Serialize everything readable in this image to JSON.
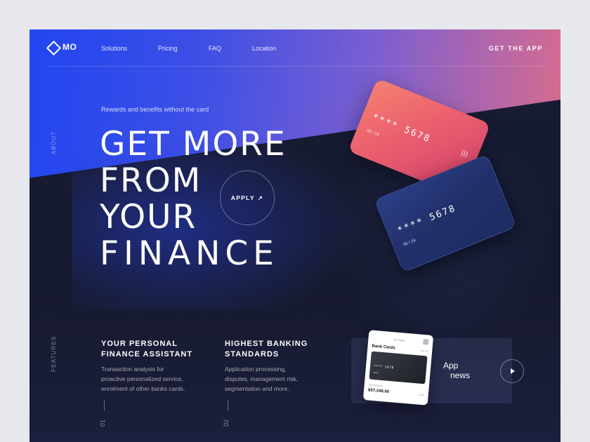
{
  "nav": {
    "logo": "MO",
    "links": [
      "Solutions",
      "Pricing",
      "FAQ",
      "Location"
    ],
    "cta": "GET THE APP"
  },
  "side_labels": {
    "about": "ABOUT",
    "features": "FEATURES"
  },
  "hero": {
    "tagline": "Rewards and benefits without the card",
    "headline": [
      "GET MORE",
      "FROM",
      "YOUR",
      "FINANCE"
    ],
    "apply_label": "APPLY",
    "apply_arrow": "↗"
  },
  "cards": [
    {
      "number": "**** 5678",
      "expiry": "05 / 24",
      "color": "#ea5f6e"
    },
    {
      "number": "**** 5678",
      "expiry": "05 / 24",
      "color": "#22306a"
    }
  ],
  "features": [
    {
      "title_lines": [
        "YOUR PERSONAL",
        "FINANCE ASSISTANT"
      ],
      "text_lines": [
        "Transaction analysis for",
        "proactive personalized service,",
        "enrolment of other banks cards."
      ],
      "index": "01"
    },
    {
      "title_lines": [
        "HIGHEST BANKING",
        "STANDARDS"
      ],
      "text_lines": [
        "Application processing,",
        "disputes, management risk,",
        "segmentation and more."
      ],
      "index": "02"
    }
  ],
  "app_news": {
    "phone": {
      "greeting": "Hi, Dave",
      "title": "Bank Cards",
      "see_all": "See all",
      "card_number": "**** 5678",
      "card_expiry": "05/24",
      "balance_label": "Your Balance",
      "balance": "$57,348.00",
      "currency": "USD"
    },
    "label_line1": "App",
    "label_line2": "news"
  },
  "colors": {
    "accent_blue": "#2146f0",
    "accent_pink": "#e26d86",
    "dark_bg": "#161a2e"
  }
}
